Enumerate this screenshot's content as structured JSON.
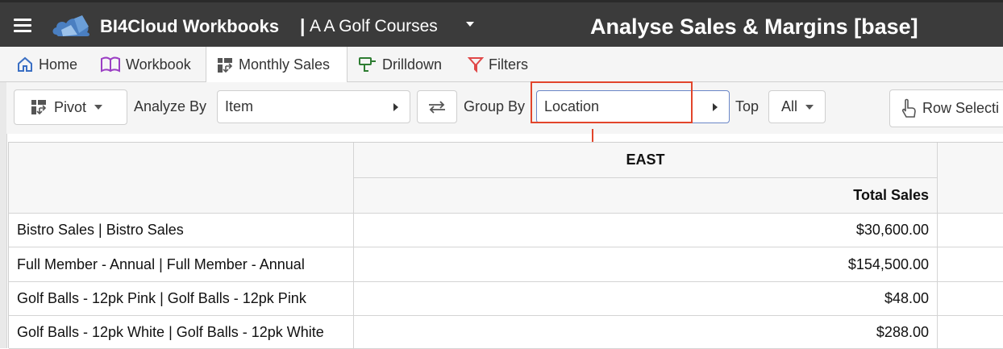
{
  "header": {
    "app_title": "BI4Cloud Workbooks",
    "separator": "|",
    "company": "A A Golf Courses",
    "page_title": "Analyse Sales & Margins [base]"
  },
  "tabs": [
    {
      "label": "Home",
      "icon": "home-icon"
    },
    {
      "label": "Workbook",
      "icon": "book-icon"
    },
    {
      "label": "Monthly Sales",
      "icon": "pivot-icon",
      "active": true
    },
    {
      "label": "Drilldown",
      "icon": "drill-icon"
    },
    {
      "label": "Filters",
      "icon": "filter-icon"
    }
  ],
  "toolbar": {
    "pivot_label": "Pivot",
    "analyze_by_label": "Analyze By",
    "analyze_by_value": "Item",
    "group_by_label": "Group By",
    "group_by_value": "Location",
    "top_label": "Top",
    "top_value": "All",
    "row_selection_label": "Row Selecti"
  },
  "table": {
    "group_header": "EAST",
    "measure_header": "Total Sales",
    "rows": [
      {
        "item": "Bistro Sales | Bistro Sales",
        "total_sales": "$30,600.00"
      },
      {
        "item": "Full Member - Annual | Full Member - Annual",
        "total_sales": "$154,500.00"
      },
      {
        "item": "Golf Balls - 12pk Pink | Golf Balls - 12pk Pink",
        "total_sales": "$48.00"
      },
      {
        "item": "Golf Balls - 12pk White | Golf Balls - 12pk White",
        "total_sales": "$288.00"
      }
    ]
  },
  "colors": {
    "topbar": "#3b3b3b",
    "highlight": "#e2452b",
    "logo_blue": "#4a7fc1"
  }
}
